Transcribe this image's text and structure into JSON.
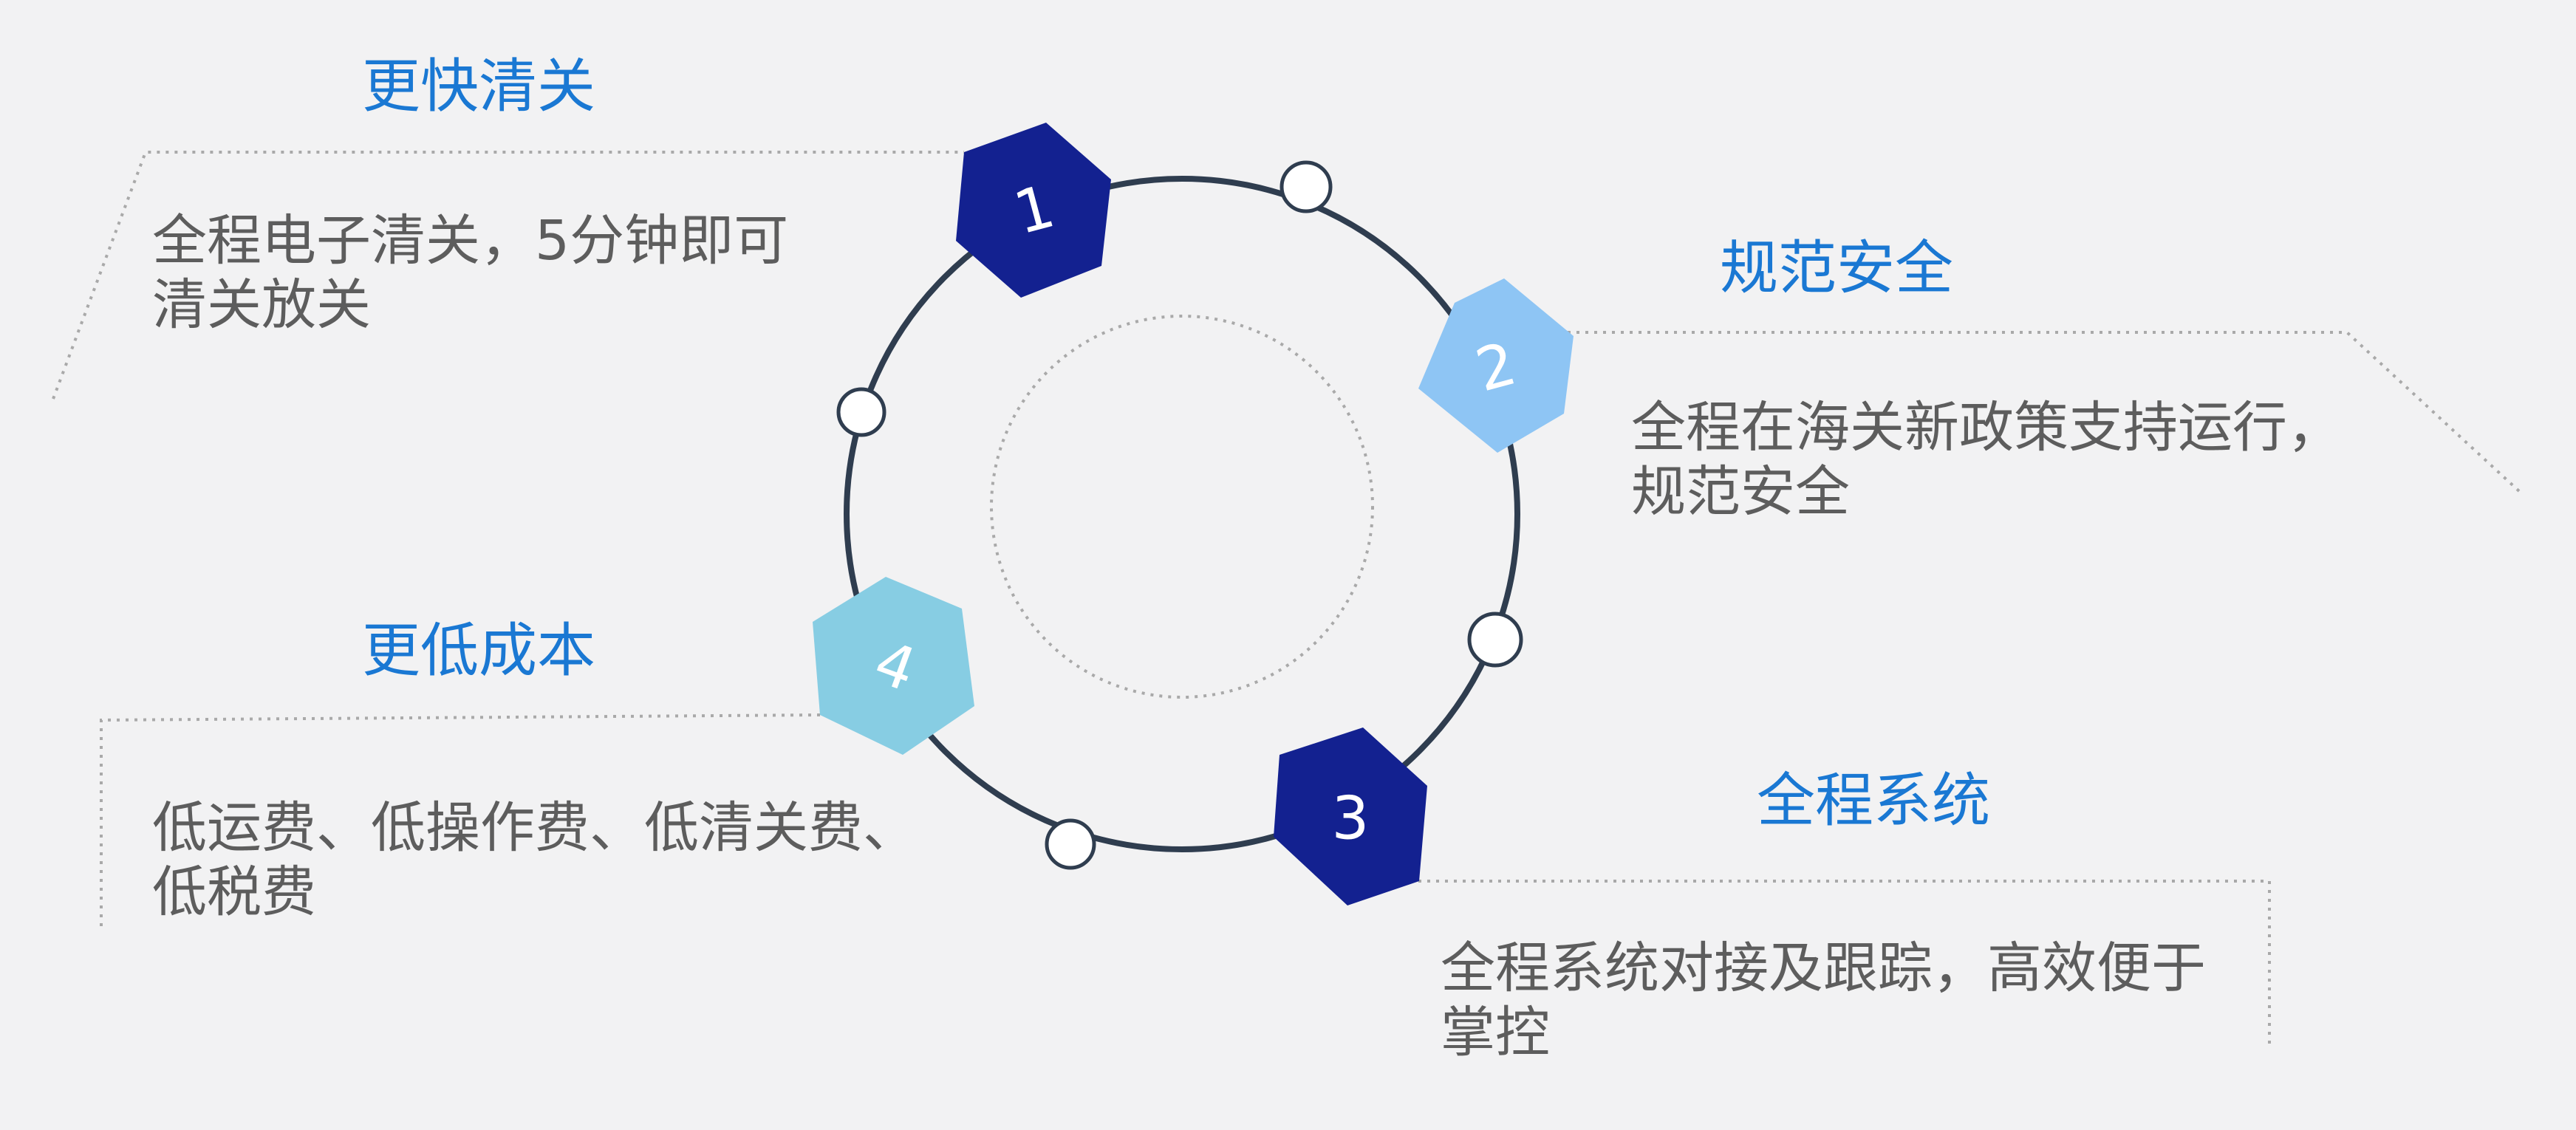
{
  "items": [
    {
      "number": "1",
      "title": "更快清关",
      "desc_lines": [
        "全程电子清关，5分钟即可",
        "清关放关"
      ],
      "color": "#132190"
    },
    {
      "number": "2",
      "title": "规范安全",
      "desc_lines": [
        "全程在海关新政策支持运行，",
        "规范安全"
      ],
      "color": "#8ec5f4"
    },
    {
      "number": "3",
      "title": "全程系统",
      "desc_lines": [
        "全程系统对接及跟踪，高效便于",
        "掌控"
      ],
      "color": "#132190"
    },
    {
      "number": "4",
      "title": "更低成本",
      "desc_lines": [
        "低运费、低操作费、低清关费、",
        "低税费"
      ],
      "color": "#87cde3"
    }
  ],
  "colors": {
    "title": "#1a78d3",
    "text": "#5d5d5d",
    "ring": "#2f3d4f",
    "leader": "#a9a9a9",
    "background": "#f2f2f3"
  }
}
